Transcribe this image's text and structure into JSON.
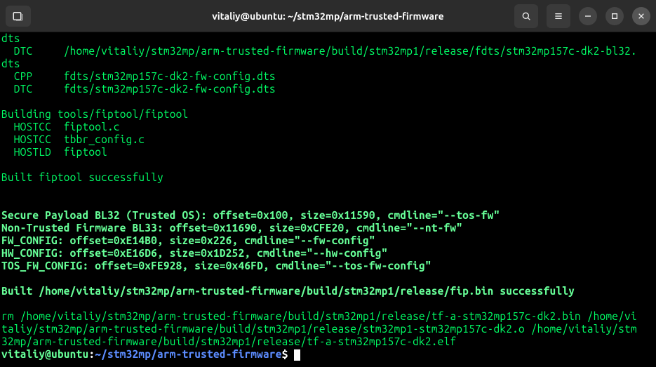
{
  "window": {
    "title": "vitaliy@ubuntu: ~/stm32mp/arm-trusted-firmware"
  },
  "terminal": {
    "lines": [
      "dts",
      "  DTC     /home/vitaliy/stm32mp/arm-trusted-firmware/build/stm32mp1/release/fdts/stm32mp157c-dk2-bl32.",
      "dts",
      "  CPP     fdts/stm32mp157c-dk2-fw-config.dts",
      "  DTC     fdts/stm32mp157c-dk2-fw-config.dts",
      "",
      "Building tools/fiptool/fiptool",
      "  HOSTCC  fiptool.c",
      "  HOSTCC  tbbr_config.c",
      "  HOSTLD  fiptool",
      "",
      "Built fiptool successfully",
      "",
      "",
      "Secure Payload BL32 (Trusted OS): offset=0x100, size=0x11590, cmdline=\"--tos-fw\"",
      "Non-Trusted Firmware BL33: offset=0x11690, size=0xCFE20, cmdline=\"--nt-fw\"",
      "FW_CONFIG: offset=0xE14B0, size=0x226, cmdline=\"--fw-config\"",
      "HW_CONFIG: offset=0xE16D6, size=0x1D252, cmdline=\"--hw-config\"",
      "TOS_FW_CONFIG: offset=0xFE928, size=0x46FD, cmdline=\"--tos-fw-config\"",
      "",
      "Built /home/vitaliy/stm32mp/arm-trusted-firmware/build/stm32mp1/release/fip.bin successfully",
      "",
      "rm /home/vitaliy/stm32mp/arm-trusted-firmware/build/stm32mp1/release/tf-a-stm32mp157c-dk2.bin /home/vi",
      "taliy/stm32mp/arm-trusted-firmware/build/stm32mp1/release/stm32mp1-stm32mp157c-dk2.o /home/vitaliy/stm",
      "32mp/arm-trusted-firmware/build/stm32mp1/release/tf-a-stm32mp157c-dk2.elf"
    ],
    "prompt": {
      "user_host": "vitaliy@ubuntu",
      "sep": ":",
      "path": "~/stm32mp/arm-trusted-firmware",
      "sigil": "$"
    }
  }
}
